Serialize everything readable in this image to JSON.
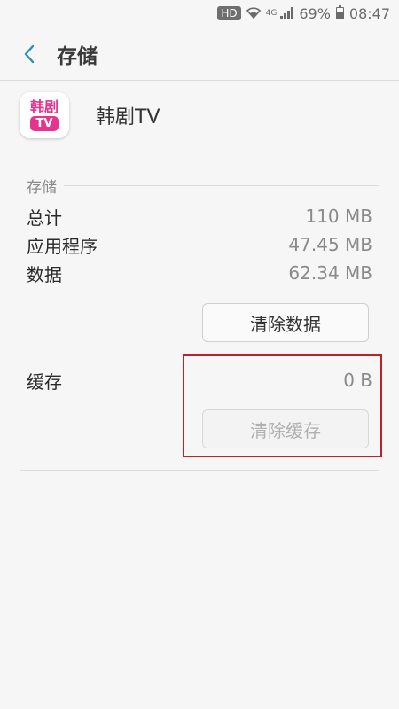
{
  "status_bar": {
    "hd": "HD",
    "network": "4G",
    "battery_percent": "69%",
    "time": "08:47",
    "battery_level": 0.69
  },
  "header": {
    "title": "存储",
    "back_icon": "chevron-left-icon"
  },
  "app": {
    "name": "韩剧TV",
    "icon_text_top": "韩剧",
    "icon_text_bottom": "TV"
  },
  "storage": {
    "section_label": "存储",
    "rows": [
      {
        "label": "总计",
        "value": "110 MB"
      },
      {
        "label": "应用程序",
        "value": "47.45 MB"
      },
      {
        "label": "数据",
        "value": "62.34 MB"
      }
    ],
    "clear_data_label": "清除数据"
  },
  "cache": {
    "label": "缓存",
    "value": "0 B",
    "clear_cache_label": "清除缓存"
  },
  "colors": {
    "accent": "#2c8fb3",
    "highlight": "#c0202a",
    "app_pink": "#e6338c"
  }
}
